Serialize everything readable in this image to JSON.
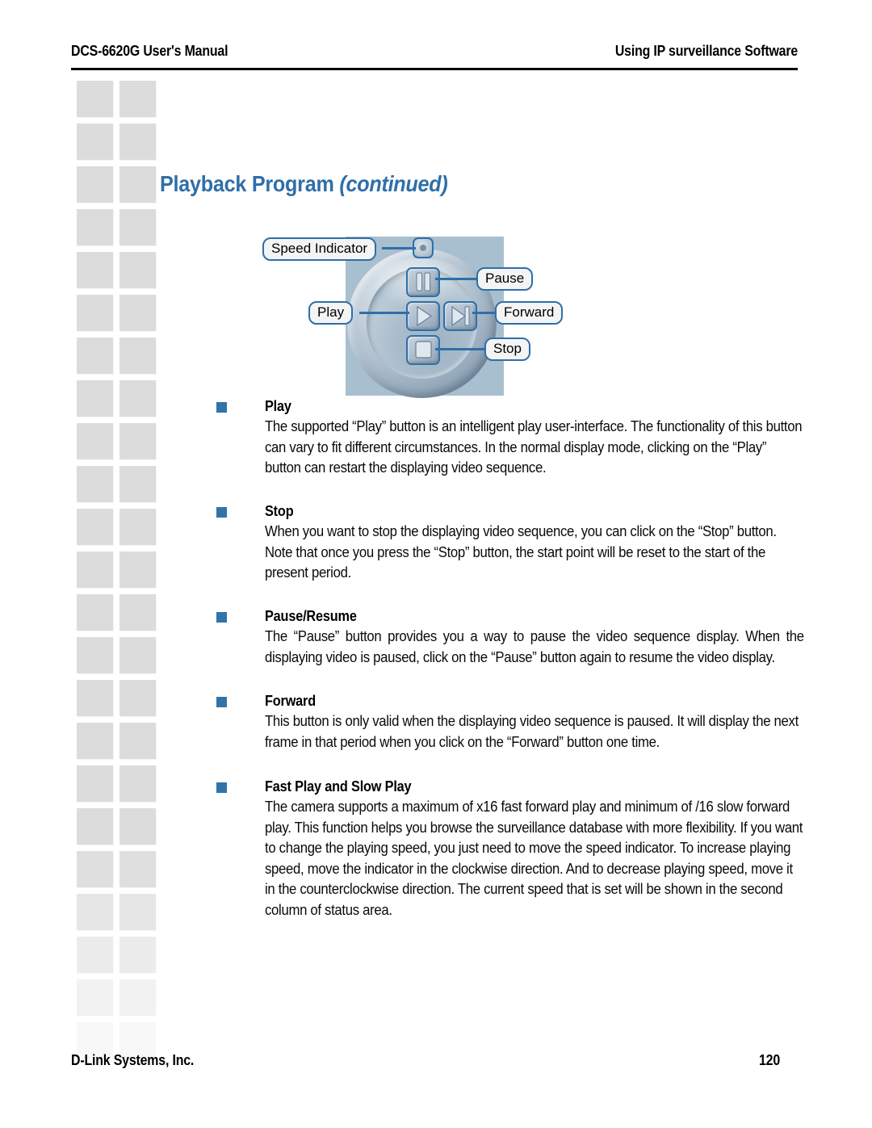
{
  "header": {
    "left": "DCS-6620G User's Manual",
    "right": "Using IP surveillance Software"
  },
  "title": {
    "main": "Playback Program ",
    "continued": "(continued)"
  },
  "diagram": {
    "name": "playback-control-dial",
    "labels": {
      "speed_indicator": "Speed Indicator",
      "pause": "Pause",
      "play": "Play",
      "forward": "Forward",
      "stop": "Stop"
    },
    "background_color": "#a8bfd0",
    "accent_color": "#2f6fa8"
  },
  "sections": [
    {
      "id": "play",
      "heading": "Play",
      "body": "The supported “Play” button is an intelligent play user-interface. The functionality of this button can vary to fit different circumstances. In the normal display mode, clicking on the “Play” button can restart the displaying video sequence."
    },
    {
      "id": "stop",
      "heading": "Stop",
      "body": "When you want to stop the displaying video sequence, you can click on the “Stop” button. Note that once you press the “Stop” button, the start point will be reset to the start of the present period."
    },
    {
      "id": "pause",
      "heading": "Pause/Resume",
      "body": "The “Pause” button provides you a way to pause the video sequence display. When the displaying video is paused, click on the “Pause” button again to resume the video display."
    },
    {
      "id": "forward",
      "heading": "Forward",
      "body": "This button is only valid when the displaying video sequence is paused. It will display the next frame in that period when you click on the “Forward” button one time."
    },
    {
      "id": "fastslow",
      "heading": "Fast Play and Slow Play",
      "body": "The camera supports a maximum of x16 fast forward play and minimum of /16 slow forward play. This function helps you browse the surveillance database with more flexibility. If you want to change the playing speed, you just need to move the speed indicator. To increase playing speed, move the indicator in the clockwise direction. And to decrease playing speed, move it in the counterclockwise direction. The current speed that is set will be shown in the second column of status area."
    }
  ],
  "footer": {
    "left": "D-Link Systems, Inc.",
    "page_number": "120"
  },
  "decor": {
    "square_color": "#dcdcdc"
  }
}
